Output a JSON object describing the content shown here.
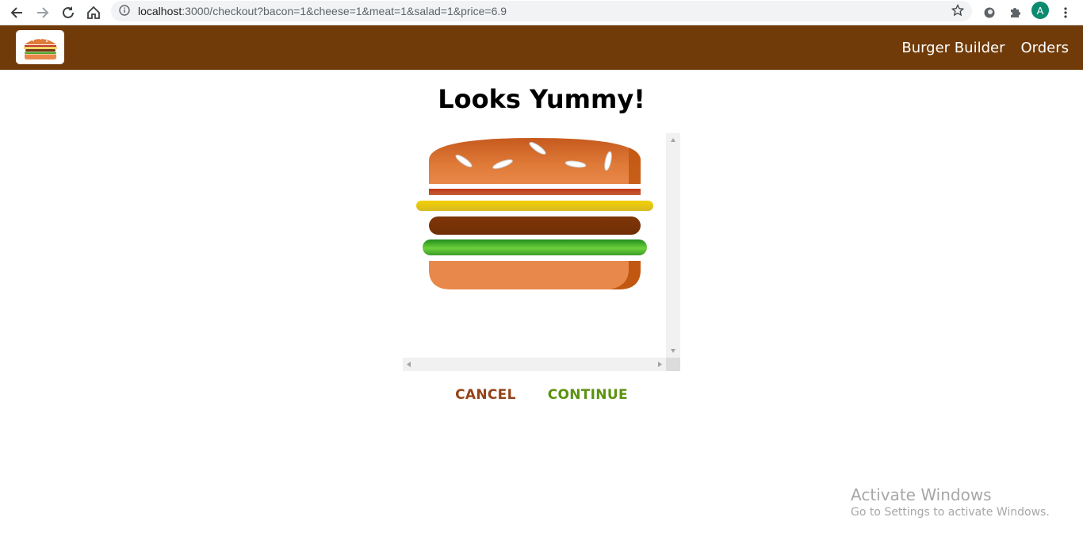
{
  "browser": {
    "url_host": "localhost",
    "url_path": ":3000/checkout?bacon=1&cheese=1&meat=1&salad=1&price=6.9",
    "profile_initial": "A"
  },
  "toolbar": {
    "nav": [
      {
        "label": "Burger Builder"
      },
      {
        "label": "Orders"
      }
    ],
    "bg_color": "#703b09"
  },
  "checkout": {
    "title": "Looks Yummy!",
    "ingredients": [
      "bacon",
      "cheese",
      "meat",
      "salad"
    ],
    "cancel_label": "CANCEL",
    "continue_label": "CONTINUE"
  },
  "watermark": {
    "line1": "Activate Windows",
    "line2": "Go to Settings to activate Windows."
  }
}
